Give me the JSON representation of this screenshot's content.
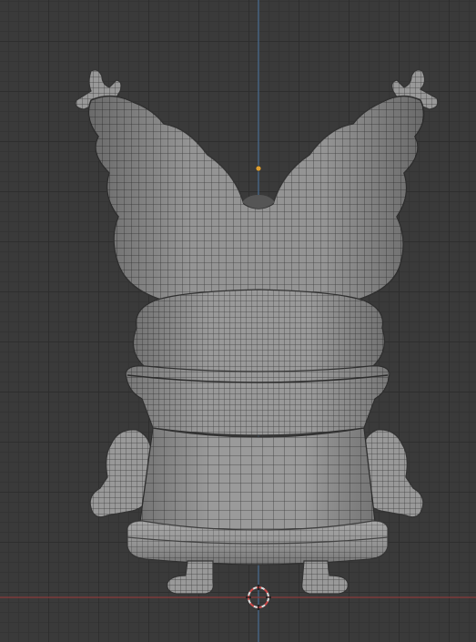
{
  "viewport": {
    "grid_color": "#2e2e2e",
    "background_color": "#3a3a3a",
    "axis_x_color": "#8a3a3a",
    "axis_z_color": "#4a6f94",
    "mesh_fill": "#8e8e8e",
    "wire_color": "#333333",
    "origin_color": "#e0a030",
    "cursor_color": "#e0e0e0",
    "cursor_accent": "#d04a4a"
  }
}
